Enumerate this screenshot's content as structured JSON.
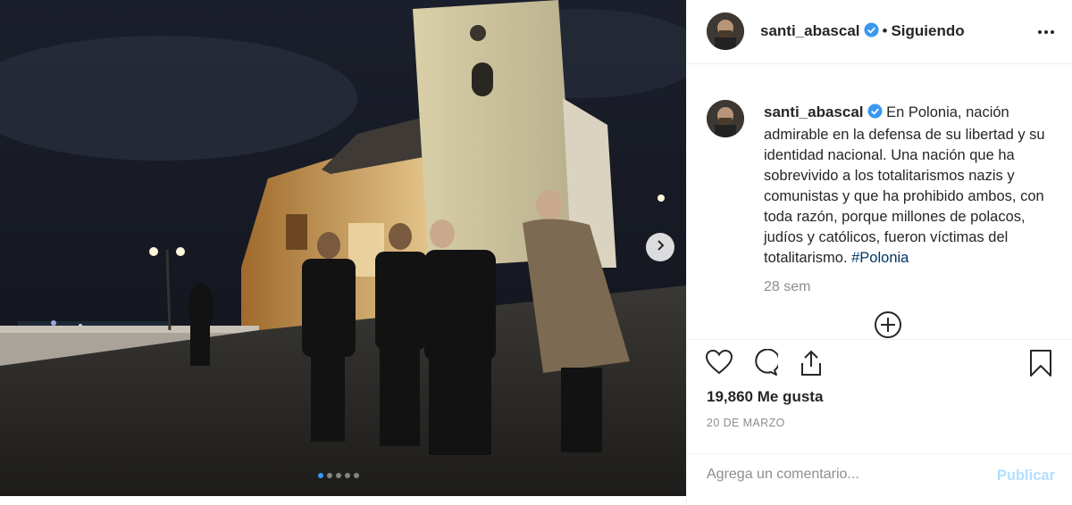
{
  "post": {
    "username": "santi_abascal",
    "separator": "•",
    "follow_status": "Siguiendo",
    "caption_text": "En Polonia, nación admirable en la defensa de su libertad y su identidad nacional. Una nación que ha sobrevivido a los totalitarismos nazis y comunistas y que ha prohibido ambos, con toda razón, porque millones de polacos, judíos y católicos, fueron víctimas del totalitarismo.",
    "hashtag": "#Polonia",
    "time_ago": "28 sem",
    "likes": "19,860 Me gusta",
    "date": "20 DE MARZO"
  },
  "carousel": {
    "total": 5,
    "active_index": 0
  },
  "comment": {
    "placeholder": "Agrega un comentario...",
    "publish_label": "Publicar"
  },
  "icons": {
    "more": "more-icon",
    "verified": "verified-badge-icon",
    "load_more": "plus-circle-icon",
    "like": "heart-icon",
    "comment": "comment-icon",
    "share": "share-icon",
    "save": "bookmark-icon",
    "next": "chevron-right-icon"
  },
  "colors": {
    "verified": "#3897f0",
    "hashtag": "#003569",
    "publish": "#b2dffc",
    "muted": "#8e8e8e"
  }
}
